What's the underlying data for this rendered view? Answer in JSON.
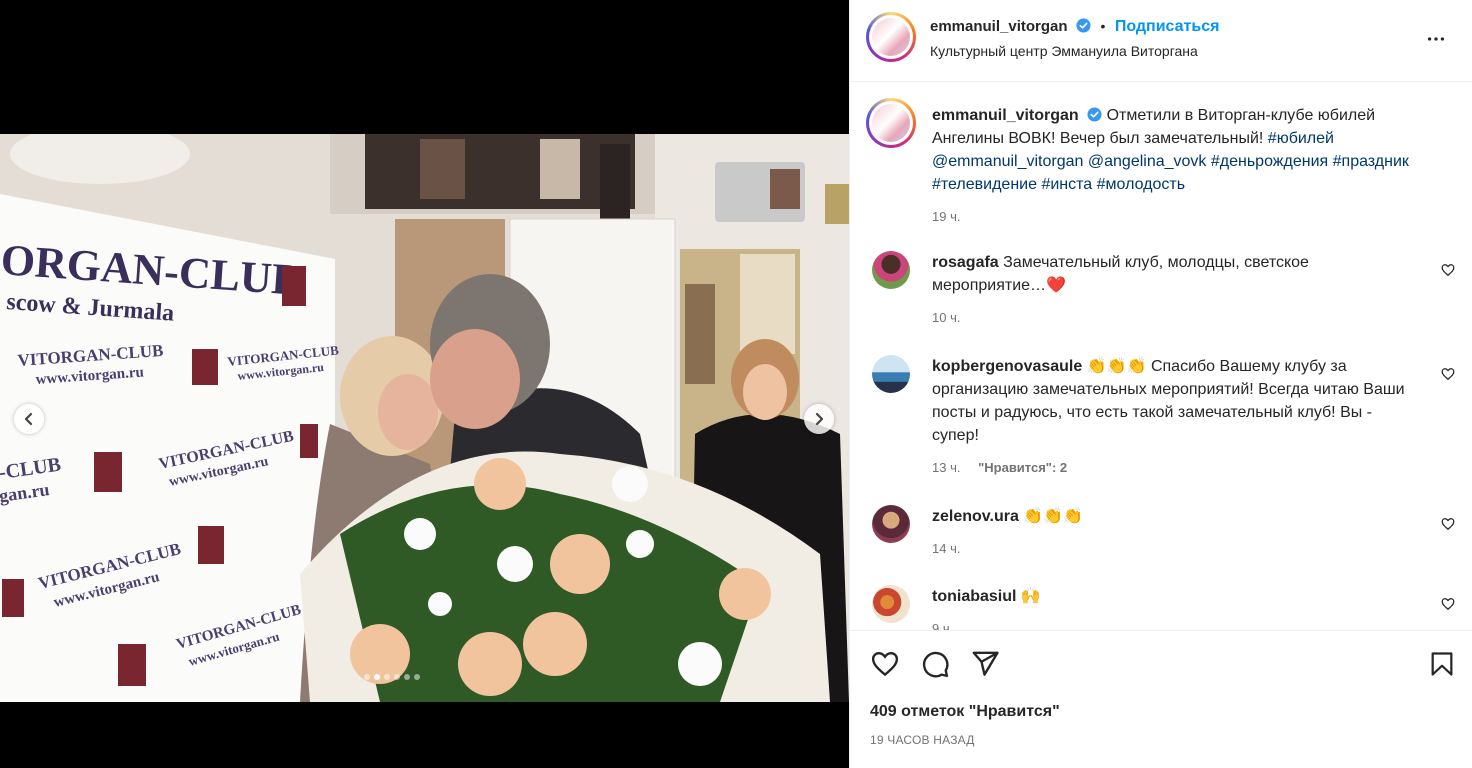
{
  "post": {
    "username": "emmanuil_vitorgan",
    "follow_label": "Подписаться",
    "separator": "•",
    "location": "Культурный центр Эммануила Виторгана"
  },
  "photo": {
    "banner_lines": [
      "ORGAN-CLUB",
      "scow & Jurmala"
    ],
    "wall_labels": [
      "VITORGAN-CLUB",
      "www.vitorgan.ru",
      "VITORGAN-CLUB",
      "www.vitorgan.ru",
      "VITORGAN-CLUB",
      "www.vitorgan.ru",
      "VITORGAN-CLUB",
      "www.vitorgan.ru",
      "-CLUB",
      "gan.ru",
      "VITORGAN-CLUB",
      "www.vitorgan.ru"
    ],
    "carousel_dots": 6,
    "active_dot": 1
  },
  "caption": {
    "username": "emmanuil_vitorgan",
    "text": "Отметили в Виторган-клубе юбилей Ангелины ВОВК! Вечер был замечательный!",
    "tags": [
      "#юбилей",
      "@emmanuil_vitorgan",
      "@angelina_vovk",
      "#деньрождения",
      "#праздник",
      "#телевидение",
      "#инста",
      "#молодость"
    ],
    "time": "19 ч."
  },
  "comments": [
    {
      "username": "rosagafa",
      "text": "Замечательный клуб, молодцы, светское мероприятие…",
      "emoji": "❤️",
      "time": "10 ч.",
      "likes": ""
    },
    {
      "username": "kopbergenovasaule",
      "emoji": "👏👏👏",
      "text": "Спасибо Вашему клубу за организацию замечательных мероприятий! Всегда читаю Ваши посты и радуюсь, что есть такой замечательный клуб! Вы - супер!",
      "time": "13 ч.",
      "likes": "\"Нравится\": 2"
    },
    {
      "username": "zelenov.ura",
      "emoji": "👏👏👏",
      "text": "",
      "time": "14 ч.",
      "likes": ""
    },
    {
      "username": "toniabasiul",
      "emoji": "🙌",
      "text": "",
      "time": "9 ч.",
      "likes": ""
    }
  ],
  "footer": {
    "likes": "409 отметок \"Нравится\"",
    "time_ago": "19 ЧАСОВ НАЗАД"
  },
  "icons": [
    "heart-icon",
    "comment-icon",
    "share-icon",
    "bookmark-icon",
    "more-icon",
    "verified-badge-icon",
    "chevron-left-icon",
    "chevron-right-icon"
  ],
  "colors": {
    "accent": "#0095f6",
    "link": "#00376b",
    "verified": "#3897f0",
    "muted": "#737373",
    "heart": "#ed4956"
  }
}
